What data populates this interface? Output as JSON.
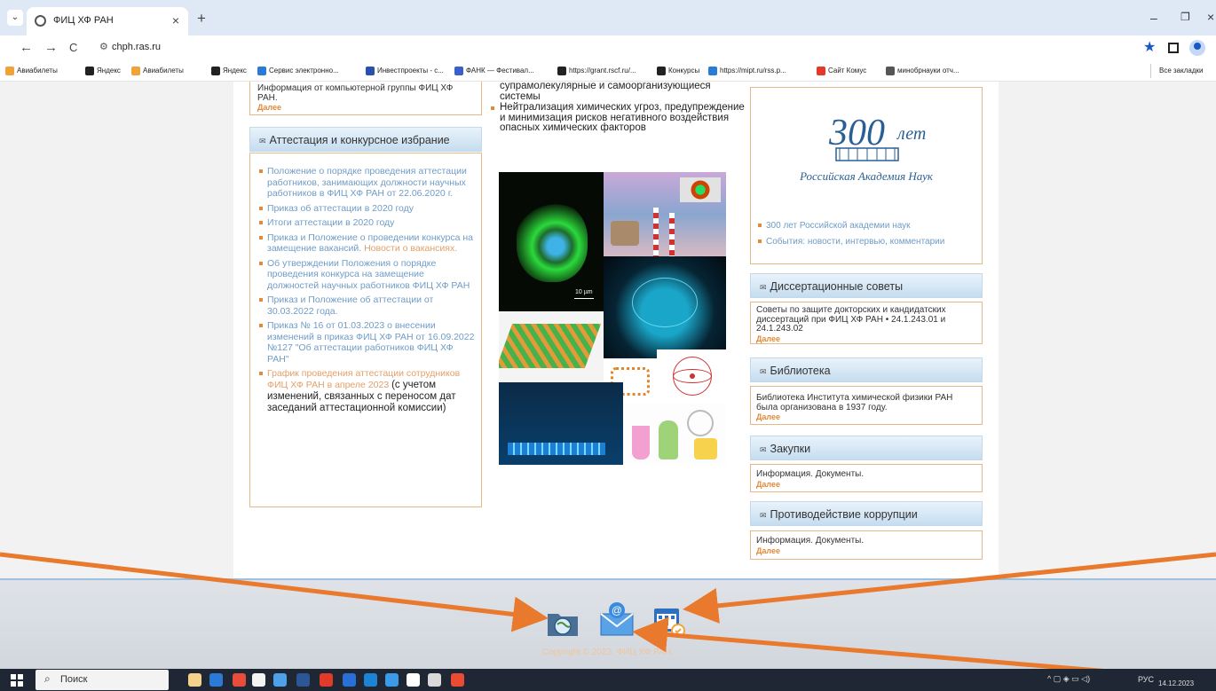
{
  "browser": {
    "tab_title": "ФИЦ ХФ РАН",
    "tab_close": "×",
    "new_tab": "+",
    "tab_menu": "⌄",
    "url": "chph.ras.ru",
    "back": "←",
    "forward": "→",
    "reload": "C",
    "star": "★",
    "min": "–",
    "max": "❐",
    "close": "×",
    "bookmarks": [
      {
        "label": "Авиабилеты",
        "color": "#f2a23b"
      },
      {
        "label": "Яндекс",
        "color": "#222222"
      },
      {
        "label": "Авиабилеты",
        "color": "#f2a23b"
      },
      {
        "label": "Яндекс",
        "color": "#222222"
      },
      {
        "label": "Сервис электронно...",
        "color": "#2a7bd3"
      },
      {
        "label": "Инвестпроекты - с...",
        "color": "#2a4fb0"
      },
      {
        "label": "ФАНК — Фестивал...",
        "color": "#3b5ec9"
      },
      {
        "label": "https://grant.rscf.ru/...",
        "color": "#222222"
      },
      {
        "label": "Конкурсы",
        "color": "#222222"
      },
      {
        "label": "https://mipt.ru/rss.p...",
        "color": "#2a7bd3"
      },
      {
        "label": "Сайт Комус",
        "color": "#e23b2a"
      },
      {
        "label": "минобрнауки отч...",
        "color": "#555555"
      }
    ],
    "bookmarks_all": "Все закладки"
  },
  "left": {
    "top_news_text": "Информация от компьютерной группы ФИЦ ХФ РАН.",
    "top_news_more": "Далее",
    "attestation_title": "Аттестация и конкурсное избрание",
    "items": [
      {
        "text": "Положение о порядке проведения аттестации работников, занимающих должности научных работников в ФИЦ ХФ РАН от 22.06.2020 г."
      },
      {
        "text": "Приказ об аттестации в 2020 году"
      },
      {
        "text": "Итоги аттестации в 2020 году"
      },
      {
        "text": "Приказ и Положение о проведении конкурса на замещение вакансий.",
        "extra": "Новости о вакансиях."
      },
      {
        "text": "Об утверждении Положения о порядке проведения конкурса на замещение должностей научных работников ФИЦ ХФ РАН"
      },
      {
        "text": "Приказ и Положение об аттестации от 30.03.2022 года."
      },
      {
        "text": "Приказ № 16 от 01.03.2023 о внесении изменений в приказ ФИЦ ХФ РАН от 16.09.2022 №127 \"Об аттестации работников ФИЦ ХФ РАН\""
      },
      {
        "text": "График проведения аттестации сотрудников ФИЦ ХФ РАН в апреле 2023",
        "dark": "(с учетом изменений, связанных с переносом дат заседаний аттестационной комиссии)"
      }
    ]
  },
  "middle": {
    "line1": "супрамолекулярные и самоорганизующиеся системы",
    "bullet": "Нейтрализация химических угроз, предупреждение и минимизация рисков негативного воздействия опасных химических факторов",
    "scale_label": "10 µm"
  },
  "right": {
    "logo_caption": "Российская Академия Наук",
    "logo_300": "300",
    "logo_let": "лет",
    "logo_links": [
      "300 лет Российской академии наук",
      "События: новости, интервью, комментарии"
    ],
    "dissertation_title": "Диссертационные советы",
    "dissertation_text": "Советы по защите докторских и кандидатских диссертаций при ФИЦ ХФ РАН • 24.1.243.01 и 24.1.243.02",
    "library_title": "Библиотека",
    "library_text": "Библиотека Института химической физики РАН была организована в 1937 году.",
    "purchases_title": "Закупки",
    "purchases_text": "Информация. Документы.",
    "corruption_title": "Противодействие коррупции",
    "corruption_text": "Информация. Документы.",
    "more": "Далее"
  },
  "footer": {
    "copyright": "Copyright © 2023. ФИЦ ХФ РАН."
  },
  "taskbar": {
    "search_placeholder": "Поиск",
    "lang": "РУС",
    "date": "14.12.2023",
    "apps": [
      "#f5d28b",
      "#2d7ad6",
      "#e84c3d",
      "#f3f3f3",
      "#4ea0e8",
      "#2b5797",
      "#e23b2a",
      "#2a6fd6",
      "#1d83d4",
      "#3b9be8",
      "#ffffff",
      "#d9d9d9",
      "#e94b35"
    ]
  }
}
